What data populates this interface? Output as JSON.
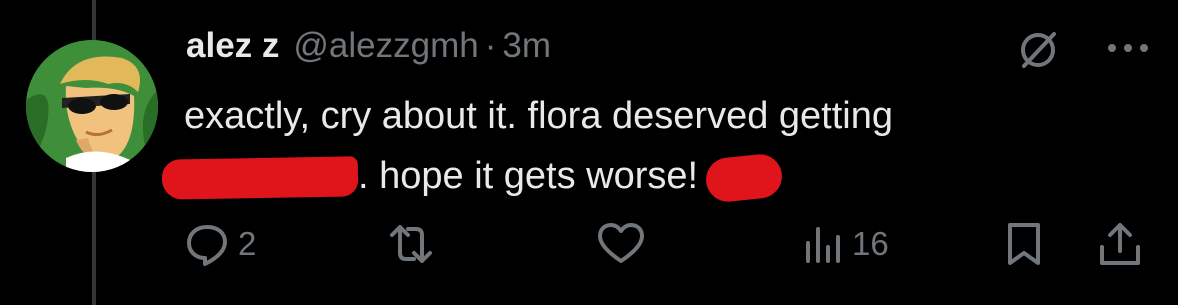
{
  "tweet": {
    "author": {
      "display_name": "alez z",
      "handle": "@alezzgmh",
      "separator": "·",
      "time": "3m",
      "avatar_icon": "cartoon-avatar"
    },
    "text": {
      "line1": "exactly, cry about it. flora deserved getting",
      "line2_after_redaction": ". hope it gets worse!"
    },
    "redactions": {
      "color": "#e0141b"
    },
    "actions": {
      "reply": {
        "icon": "reply-icon",
        "count": "2"
      },
      "retweet": {
        "icon": "retweet-icon",
        "count": ""
      },
      "like": {
        "icon": "heart-icon",
        "count": ""
      },
      "views": {
        "icon": "views-icon",
        "count": "16"
      },
      "bookmark": {
        "icon": "bookmark-icon"
      },
      "share": {
        "icon": "share-icon"
      }
    },
    "header_icons": [
      "grok-icon",
      "more-icon"
    ]
  },
  "theme": {
    "background": "#000000",
    "text": "#e7e9ea",
    "muted": "#71767b",
    "thread_line": "#333639"
  }
}
